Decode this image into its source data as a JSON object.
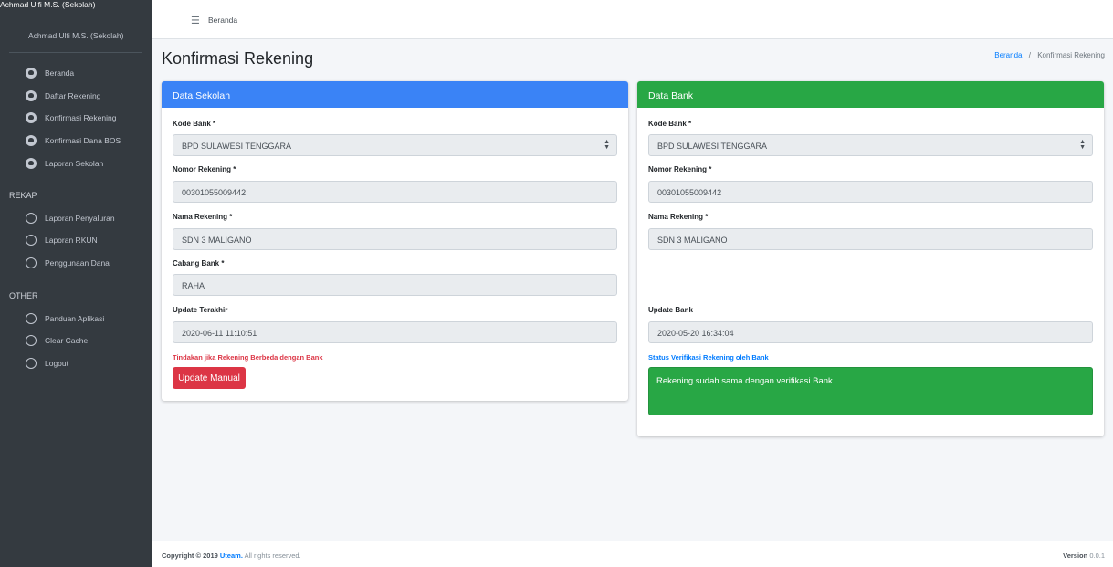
{
  "sidebar": {
    "brand": "Achmad Ulfi M.S. (Sekolah)",
    "user": "Achmad Ulfi M.S. (Sekolah)",
    "menu": [
      {
        "label": "Beranda",
        "icon": "dashboard-icon"
      },
      {
        "label": "Daftar Rekening",
        "icon": "dashboard-icon"
      },
      {
        "label": "Konfirmasi Rekening",
        "icon": "dashboard-icon"
      },
      {
        "label": "Konfirmasi Dana BOS",
        "icon": "dashboard-icon"
      },
      {
        "label": "Laporan Sekolah",
        "icon": "dashboard-icon"
      }
    ],
    "rekap_header": "REKAP",
    "rekap": [
      {
        "label": "Laporan Penyaluran",
        "icon": "circle-icon"
      },
      {
        "label": "Laporan RKUN",
        "icon": "circle-icon"
      },
      {
        "label": "Penggunaan Dana",
        "icon": "circle-icon"
      }
    ],
    "other_header": "OTHER",
    "other": [
      {
        "label": "Panduan Aplikasi",
        "icon": "circle-icon"
      },
      {
        "label": "Clear Cache",
        "icon": "circle-icon"
      },
      {
        "label": "Logout",
        "icon": "circle-icon"
      }
    ]
  },
  "topbar": {
    "menu_icon": "hamburger-icon",
    "home_link": "Beranda"
  },
  "page": {
    "title": "Konfirmasi Rekening",
    "breadcrumb": {
      "home": "Beranda",
      "separator": "/",
      "current": "Konfirmasi Rekening"
    }
  },
  "sekolah": {
    "header": "Data Sekolah",
    "header_color": "#3a83f6",
    "kode_bank_label": "Kode Bank *",
    "kode_bank_value": "BPD SULAWESI TENGGARA",
    "nomor_label": "Nomor Rekening *",
    "nomor_value": "00301055009442",
    "nama_label": "Nama Rekening *",
    "nama_value": "SDN 3 MALIGANO",
    "cabang_label": "Cabang Bank *",
    "cabang_value": "RAHA",
    "update_label": "Update Terakhir",
    "update_value": "2020-06-11 11:10:51",
    "warning": "Tindakan jika Rekening Berbeda dengan Bank",
    "button": "Update Manual"
  },
  "bank": {
    "header": "Data Bank",
    "header_color": "#28a745",
    "kode_bank_label": "Kode Bank *",
    "kode_bank_value": "BPD SULAWESI TENGGARA",
    "nomor_label": "Nomor Rekening *",
    "nomor_value": "00301055009442",
    "nama_label": "Nama Rekening *",
    "nama_value": "SDN 3 MALIGANO",
    "update_label": "Update Bank",
    "update_value": "2020-05-20 16:34:04",
    "status_label": "Status Verifikasi Rekening oleh Bank",
    "status_value": "Rekening sudah sama dengan verifikasi Bank"
  },
  "footer": {
    "copyright_prefix": "Copyright © 2019",
    "brand": "Uteam.",
    "suffix": "All rights reserved.",
    "version_label": "Version",
    "version_value": "0.0.1"
  }
}
